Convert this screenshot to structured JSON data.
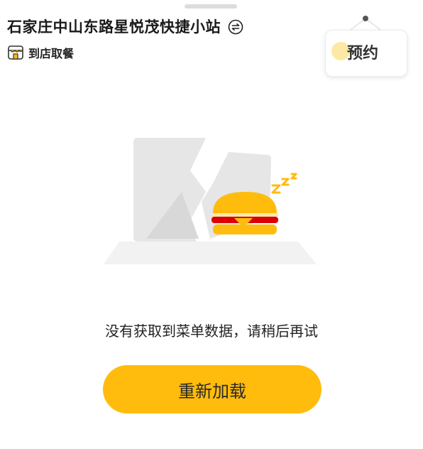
{
  "header": {
    "store_name": "石家庄中山东路星悦茂快捷小站",
    "switch_icon": "switch-arrows-icon",
    "pickup_mode": "到店取餐",
    "pickup_icon": "store-icon"
  },
  "reserve": {
    "label": "预约"
  },
  "empty_state": {
    "illustration": "sleeping-burger-illustration",
    "message": "没有获取到菜单数据，请稍后再试",
    "retry_label": "重新加载"
  },
  "colors": {
    "accent": "#ffbc0d",
    "text": "#222222",
    "burger_bun": "#ffbc0d",
    "burger_patty": "#db0007"
  }
}
